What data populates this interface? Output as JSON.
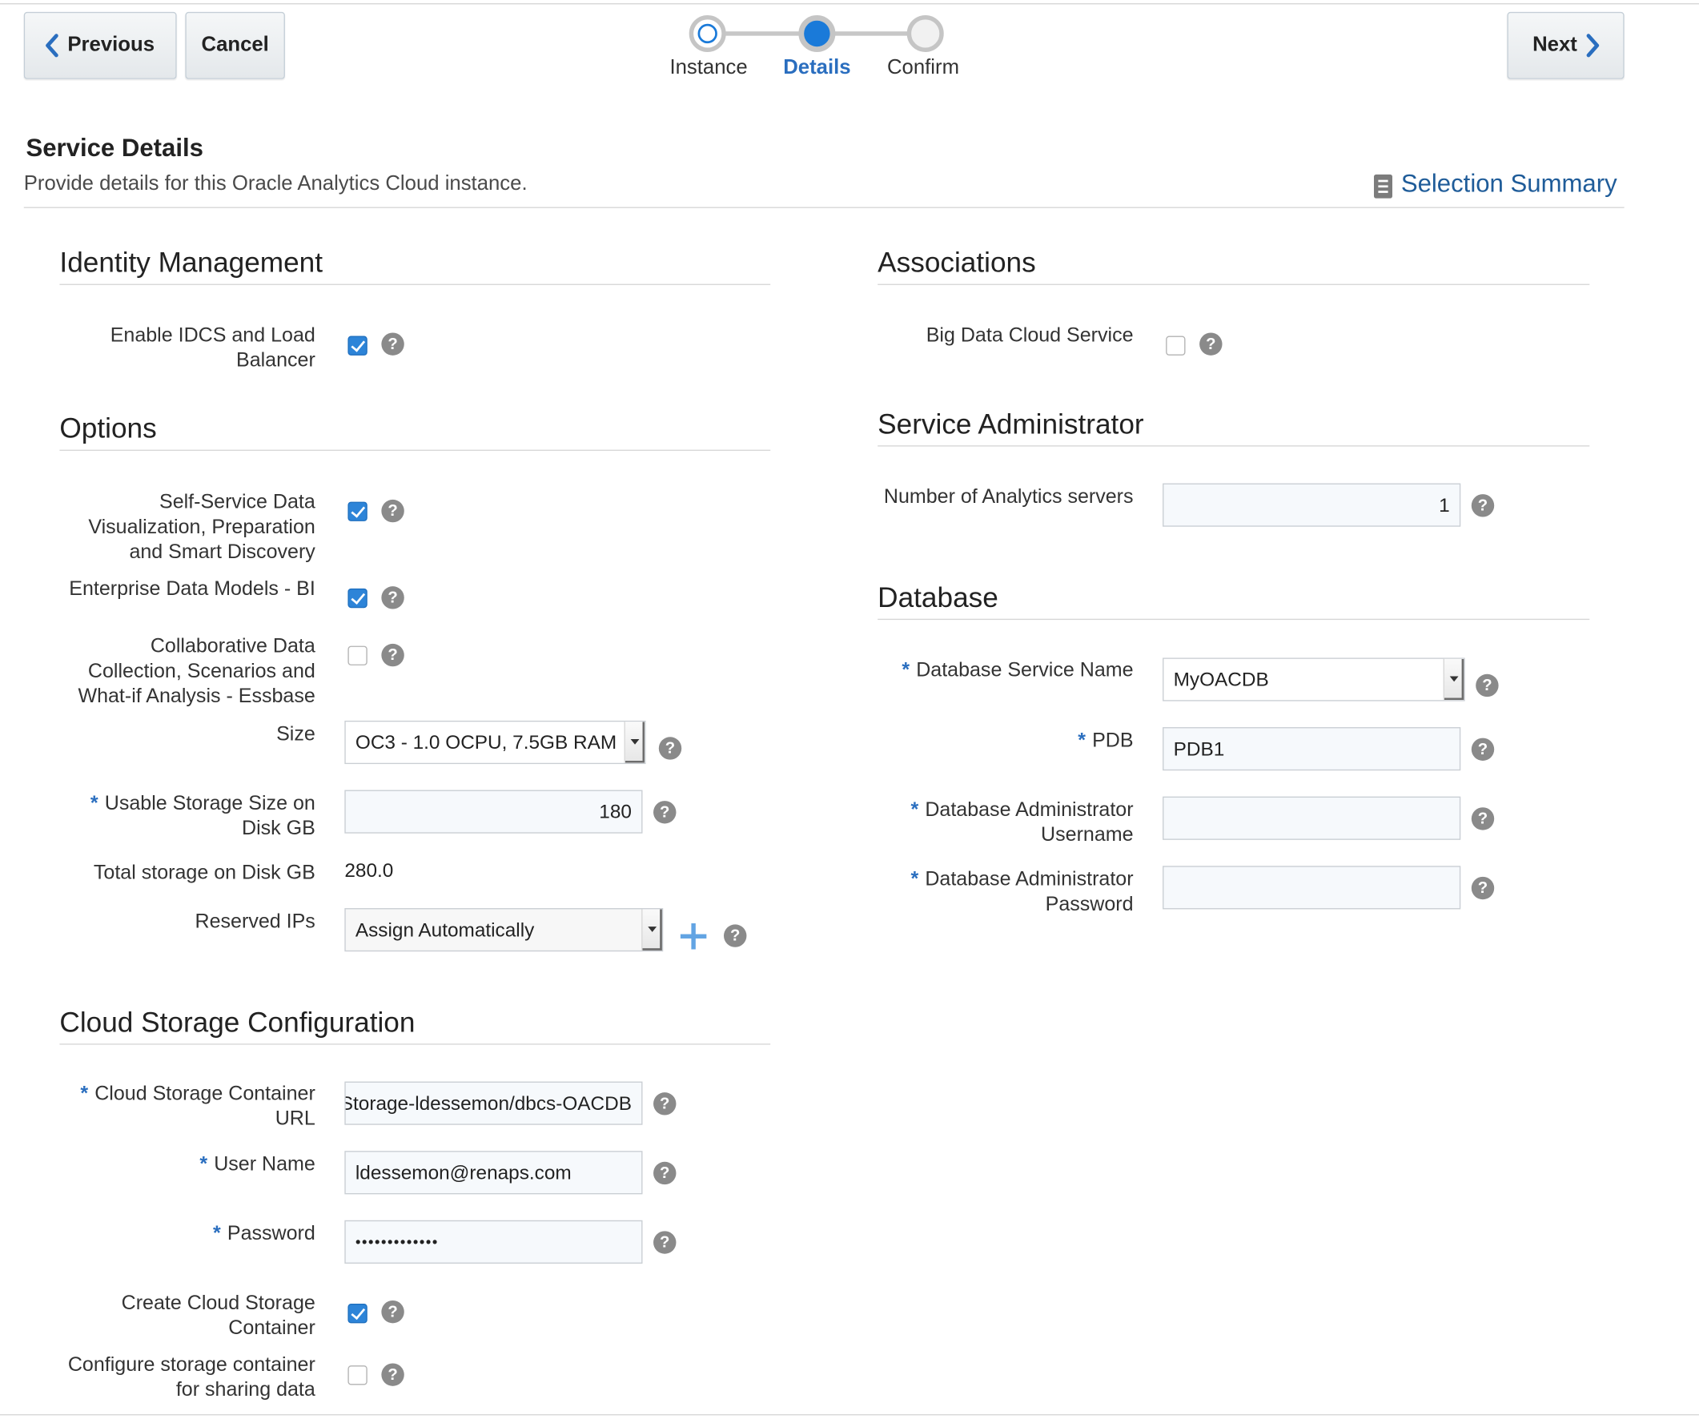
{
  "nav": {
    "previous": "Previous",
    "cancel": "Cancel",
    "next": "Next"
  },
  "train": {
    "stops": [
      "Instance",
      "Details",
      "Confirm"
    ],
    "current": "Details"
  },
  "header": {
    "title": "Service Details",
    "subtitle": "Provide details for this Oracle Analytics Cloud instance.",
    "summary_link": "Selection Summary"
  },
  "left": {
    "identity": {
      "title": "Identity Management",
      "idcs": {
        "label": "Enable IDCS and Load Balancer",
        "checked": true
      }
    },
    "options": {
      "title": "Options",
      "self_service": {
        "label": "Self-Service Data Visualization, Preparation and Smart Discovery",
        "checked": true
      },
      "enterprise": {
        "label": "Enterprise Data Models - BI",
        "checked": true
      },
      "collab": {
        "label": "Collaborative Data Collection, Scenarios and What-if Analysis - Essbase",
        "checked": false
      },
      "size": {
        "label": "Size",
        "value": "OC3 - 1.0 OCPU, 7.5GB RAM"
      },
      "usable_storage": {
        "label": "Usable Storage Size on Disk GB",
        "value": "180",
        "required": "*"
      },
      "total_storage": {
        "label": "Total storage on Disk GB",
        "value": "280.0"
      },
      "reserved_ips": {
        "label": "Reserved IPs",
        "value": "Assign Automatically"
      }
    },
    "cloud_storage": {
      "title": "Cloud Storage Configuration",
      "container_url": {
        "label": "Cloud Storage Container URL",
        "value": "Storage-ldessemon/dbcs-OACDB",
        "required": "*"
      },
      "user_name": {
        "label": "User Name",
        "value": "ldessemon@renaps.com",
        "required": "*"
      },
      "password": {
        "label": "Password",
        "value": "•••••••••••••",
        "required": "*"
      },
      "create_container": {
        "label": "Create Cloud Storage Container",
        "checked": true
      },
      "configure_sharing": {
        "label": "Configure storage container for sharing data",
        "checked": false
      }
    }
  },
  "right": {
    "associations": {
      "title": "Associations",
      "big_data": {
        "label": "Big Data Cloud Service",
        "checked": false
      }
    },
    "service_admin": {
      "title": "Service Administrator",
      "num_servers": {
        "label": "Number of Analytics servers",
        "value": "1"
      }
    },
    "database": {
      "title": "Database",
      "service_name": {
        "label": "Database Service Name",
        "value": "MyOACDB",
        "required": "*"
      },
      "pdb": {
        "label": "PDB",
        "value": "PDB1",
        "required": "*"
      },
      "admin_user": {
        "label": "Database Administrator Username",
        "value": "",
        "required": "*"
      },
      "admin_password": {
        "label": "Database Administrator Password",
        "value": "",
        "required": "*"
      }
    }
  },
  "help_glyph": "?",
  "colors": {
    "accent": "#2a6ebf",
    "checkbox": "#2d84d8",
    "link": "#1f5c99",
    "train_active": "#1a7ad9"
  }
}
